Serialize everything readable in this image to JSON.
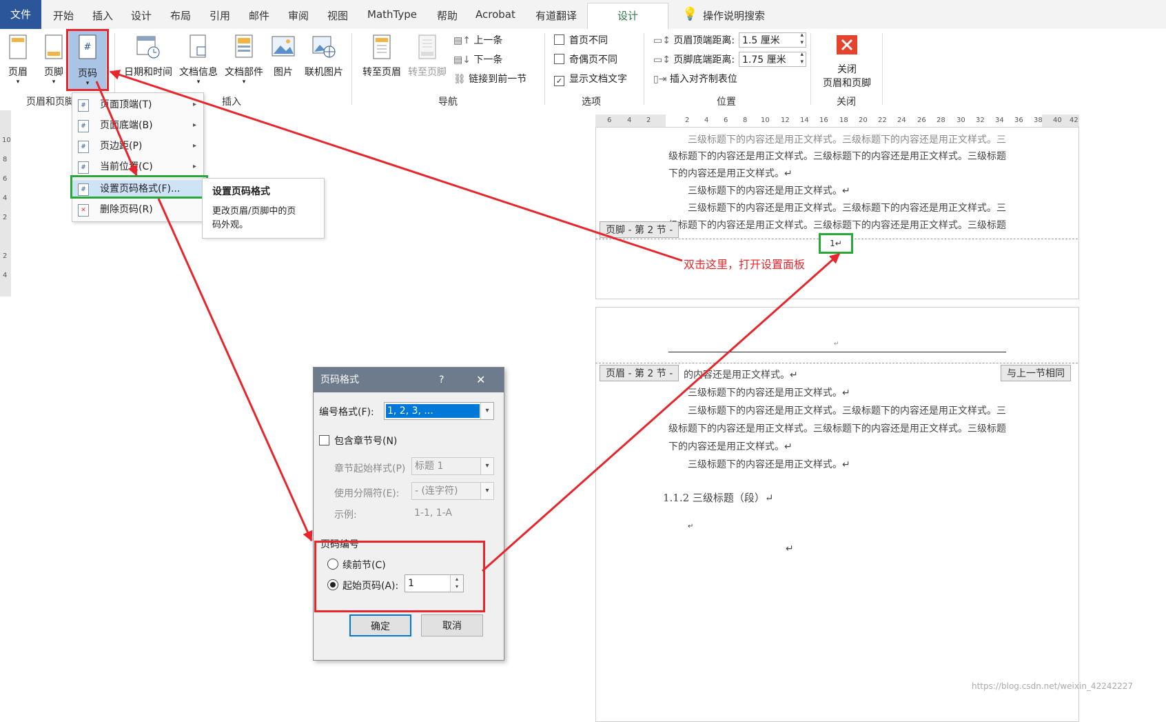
{
  "tabs": {
    "file": "文件",
    "items": [
      "开始",
      "插入",
      "设计",
      "布局",
      "引用",
      "邮件",
      "审阅",
      "视图",
      "MathType",
      "帮助",
      "Acrobat",
      "有道翻译"
    ],
    "active": "设计",
    "search": "操作说明搜索"
  },
  "ribbon": {
    "header": "页眉",
    "footer": "页脚",
    "page_number": "页码",
    "date_time": "日期和时间",
    "doc_info": "文档信息",
    "doc_parts": "文档部件",
    "picture": "图片",
    "online_picture": "联机图片",
    "goto_header": "转至页眉",
    "goto_footer": "转至页脚",
    "prev": "上一条",
    "next": "下一条",
    "link_prev": "链接到前一节",
    "first_page_diff": "首页不同",
    "odd_even_diff": "奇偶页不同",
    "show_doc_text": "显示文档文字",
    "header_top_label": "页眉顶端距离:",
    "header_top_value": "1.5 厘米",
    "footer_bottom_label": "页脚底端距离:",
    "footer_bottom_value": "1.75 厘米",
    "insert_align_tab": "插入对齐制表位",
    "close_line1": "关闭",
    "close_line2": "页眉和页脚",
    "groups": {
      "header_footer": "页眉和页脚",
      "insert": "插入",
      "navigation": "导航",
      "options": "选项",
      "position": "位置",
      "close": "关闭"
    }
  },
  "ruler": [
    "6",
    "4",
    "2",
    "2",
    "4",
    "6",
    "8",
    "10",
    "12",
    "14",
    "16",
    "18",
    "20",
    "22",
    "24",
    "26",
    "28",
    "30",
    "32",
    "34",
    "36",
    "38",
    "40",
    "42"
  ],
  "vruler": [
    "10",
    "8",
    "6",
    "4",
    "2",
    "2",
    "4"
  ],
  "menu": {
    "items": [
      {
        "label": "页面顶端(T)",
        "arrow": "▸"
      },
      {
        "label": "页面底端(B)",
        "arrow": "▸"
      },
      {
        "label": "页边距(P)",
        "arrow": "▸"
      },
      {
        "label": "当前位置(C)",
        "arrow": "▸"
      },
      {
        "label": "设置页码格式(F)...",
        "arrow": ""
      },
      {
        "label": "删除页码(R)",
        "arrow": ""
      }
    ]
  },
  "tooltip": {
    "title": "设置页码格式",
    "desc_line1": "更改页眉/页脚中的页",
    "desc_line2": "码外观。"
  },
  "document": {
    "page1_lines": [
      "三级标题下的内容还是用正文样式。三级标题下的内容还是用正文样式。三",
      "级标题下的内容还是用正文样式。三级标题下的内容还是用正文样式。三级标题",
      "下的内容还是用正文样式。↵",
      "三级标题下的内容还是用正文样式。↵",
      "三级标题下的内容还是用正文样式。三级标题下的内容还是用正文样式。三",
      "级标题下的内容还是用正文样式。三级标题下的内容还是用正文样式。三级标题"
    ],
    "footer_tag": "页脚 - 第 2 节 -",
    "page_num": "1↵",
    "annotation": "双击这里，打开设置面板",
    "header_tag": "页眉 - 第 2 节 -",
    "same_as_prev": "与上一节相同",
    "header_mark": "↵",
    "page2_lines": [
      "的内容还是用正文样式。↵",
      "三级标题下的内容还是用正文样式。↵",
      "三级标题下的内容还是用正文样式。三级标题下的内容还是用正文样式。三",
      "级标题下的内容还是用正文样式。三级标题下的内容还是用正文样式。三级标题",
      "下的内容还是用正文样式。↵",
      "三级标题下的内容还是用正文样式。↵"
    ],
    "heading": "1.1.2  三级标题（段）↵",
    "empty1": "↵",
    "empty2": "↵",
    "watermark": "https://blog.csdn.net/weixin_42242227"
  },
  "dialog": {
    "title": "页码格式",
    "help": "?",
    "close": "✕",
    "number_format_label": "编号格式(F):",
    "number_format_value": "1, 2, 3, ...",
    "include_chapter": "包含章节号(N)",
    "chapter_style_label": "章节起始样式(P)",
    "chapter_style_value": "标题 1",
    "separator_label": "使用分隔符(E):",
    "separator_value": "-  (连字符)",
    "example_label": "示例:",
    "example_value": "1-1, 1-A",
    "page_numbering": "页码编号",
    "continue": "续前节(C)",
    "start_at": "起始页码(A):",
    "start_value": "1",
    "ok": "确定",
    "cancel": "取消"
  },
  "colors": {
    "word_blue": "#2b579a",
    "design_green": "#2b7a4b",
    "arrow_red": "#e8252a",
    "hl_green": "#27a839"
  }
}
